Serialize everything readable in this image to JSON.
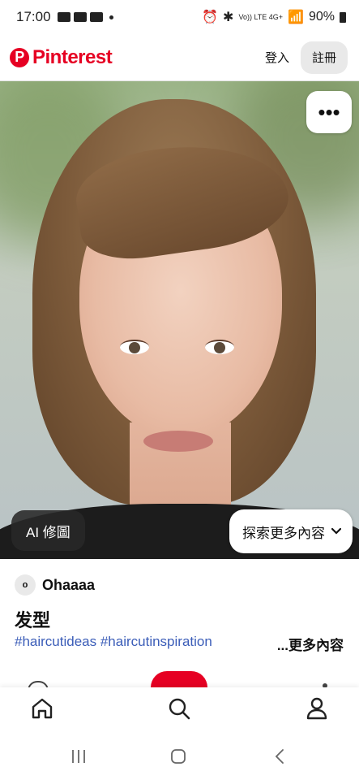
{
  "status_bar": {
    "time": "17:00",
    "signal_text": "Vo)) LTE 4G+",
    "battery": "90%"
  },
  "header": {
    "logo_mark": "P",
    "logo_text": "Pinterest",
    "login_label": "登入",
    "signup_label": "註冊"
  },
  "pin": {
    "more_label": "•••",
    "ai_edit_label": "AI 修圖",
    "explore_label": "探索更多內容",
    "explore_icon": "chevron-down-icon"
  },
  "info": {
    "avatar_letter": "o",
    "author": "Ohaaaa",
    "title": "发型",
    "hashtags": "#haircutideas #haircutinspiration",
    "more_content": "...更多內容"
  },
  "tabs": {
    "home_icon": "home-icon",
    "search_icon": "search-icon",
    "profile_icon": "profile-icon"
  },
  "colors": {
    "brand": "#e60023",
    "hashtag": "#3b5db8"
  }
}
